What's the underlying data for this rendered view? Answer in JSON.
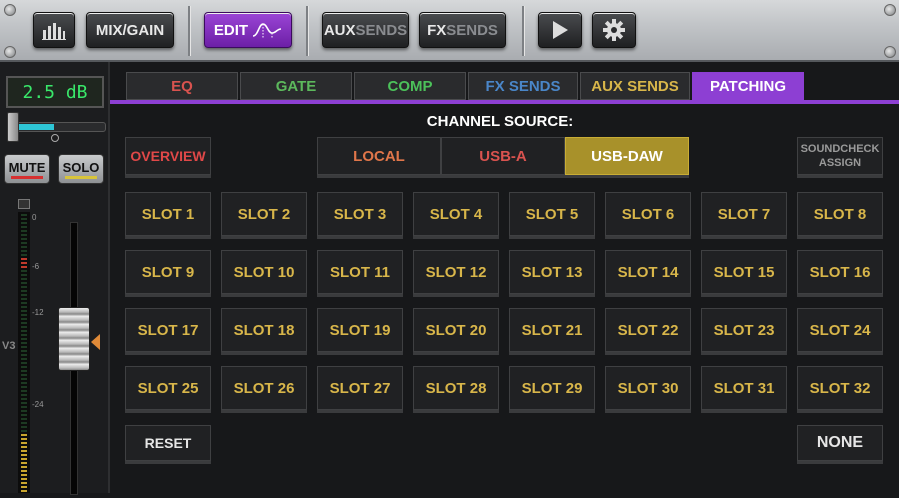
{
  "toolbar": {
    "mix_gain_label": "MIX/GAIN",
    "edit_label": "EDIT",
    "aux_sends_a": "AUX",
    "aux_sends_b": "SENDS",
    "fx_sends_a": "FX",
    "fx_sends_b": "SENDS"
  },
  "channel_strip": {
    "gain_value": "2.5 dB",
    "mute_label": "MUTE",
    "solo_label": "SOLO",
    "channel_name": "V3",
    "meter_ticks": [
      "0",
      "-6",
      "-12",
      "-24"
    ]
  },
  "tabs": [
    {
      "label": "EQ",
      "color": "#d9534f"
    },
    {
      "label": "GATE",
      "color": "#5cb85c"
    },
    {
      "label": "COMP",
      "color": "#4cc25a"
    },
    {
      "label": "FX SENDS",
      "color": "#4a86c8"
    },
    {
      "label": "AUX SENDS",
      "color": "#d8b64a"
    },
    {
      "label": "PATCHING",
      "color": "#ffffff"
    }
  ],
  "patching": {
    "channel_source_label": "CHANNEL SOURCE:",
    "overview_label": "OVERVIEW",
    "sources": [
      {
        "label": "LOCAL",
        "color": "#e0764a"
      },
      {
        "label": "USB-A",
        "color": "#d9534f"
      },
      {
        "label": "USB-DAW",
        "color": "#ffffff"
      }
    ],
    "soundcheck_label_1": "SOUNDCHECK",
    "soundcheck_label_2": "ASSIGN",
    "slots": [
      "SLOT 1",
      "SLOT 2",
      "SLOT 3",
      "SLOT 4",
      "SLOT 5",
      "SLOT 6",
      "SLOT 7",
      "SLOT 8",
      "SLOT 9",
      "SLOT 10",
      "SLOT 11",
      "SLOT 12",
      "SLOT 13",
      "SLOT 14",
      "SLOT 15",
      "SLOT 16",
      "SLOT 17",
      "SLOT 18",
      "SLOT 19",
      "SLOT 20",
      "SLOT 21",
      "SLOT 22",
      "SLOT 23",
      "SLOT 24",
      "SLOT 25",
      "SLOT 26",
      "SLOT 27",
      "SLOT 28",
      "SLOT 29",
      "SLOT 30",
      "SLOT 31",
      "SLOT 32"
    ],
    "reset_label": "RESET",
    "none_label": "NONE"
  },
  "colors": {
    "accent": "#8d3fd3",
    "slot_text": "#d8b64a",
    "selected_source": "#a8912a",
    "meter_green": "#2fa24a"
  }
}
